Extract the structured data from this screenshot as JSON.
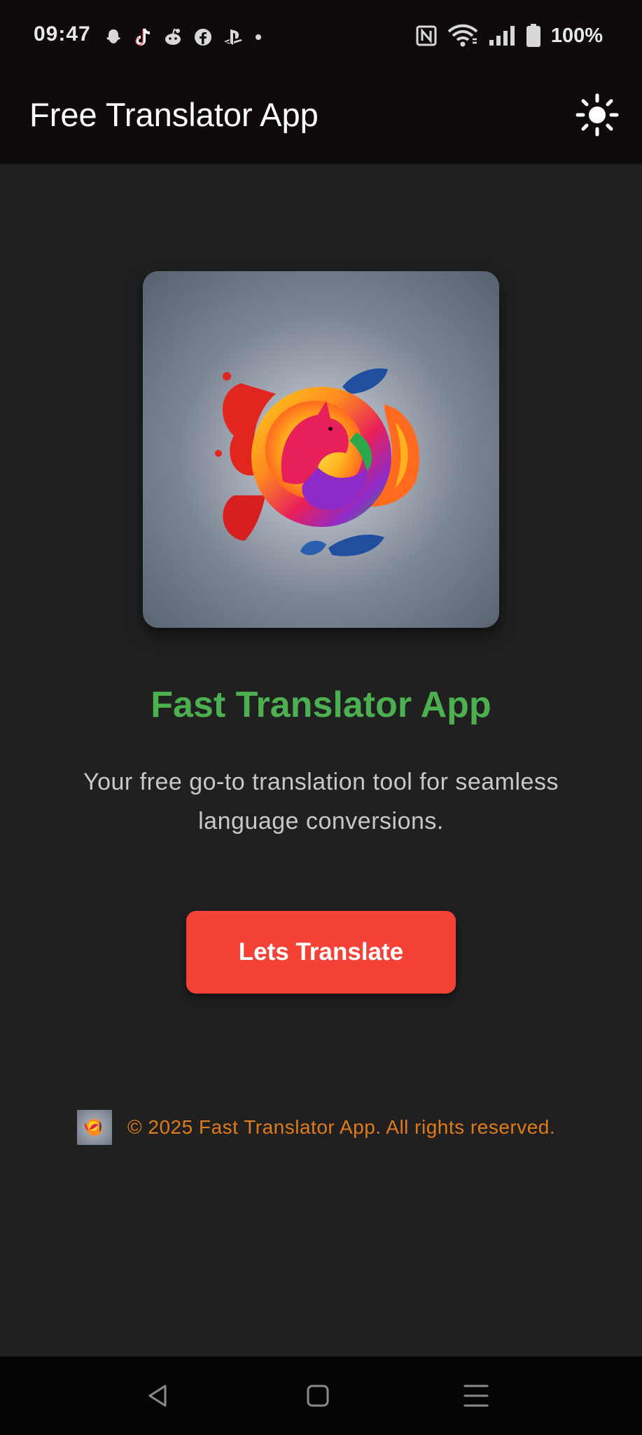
{
  "status_bar": {
    "time": "09:47",
    "notification_icons": [
      "snapchat-icon",
      "tiktok-icon",
      "reddit-icon",
      "facebook-icon",
      "playstation-icon",
      "dot-icon"
    ],
    "system_icons": [
      "nfc-icon",
      "wifi-icon",
      "signal-icon",
      "battery-icon"
    ],
    "battery": "100%"
  },
  "app_bar": {
    "title": "Free Translator App",
    "theme_icon": "sun-icon"
  },
  "main": {
    "brand_title": "Fast Translator App",
    "tagline": "Your free go-to translation tool for seamless language conversions.",
    "cta_label": "Lets Translate"
  },
  "footer": {
    "text": "© 2025 Fast Translator App. All rights reserved."
  },
  "nav_bar": {
    "buttons": [
      "back-icon",
      "home-icon",
      "menu-icon"
    ]
  },
  "colors": {
    "brand_green": "#4caf50",
    "cta_red": "#f44336",
    "footer_orange": "#e07b1c",
    "background": "#202020",
    "bar": "#0f0b0b"
  }
}
